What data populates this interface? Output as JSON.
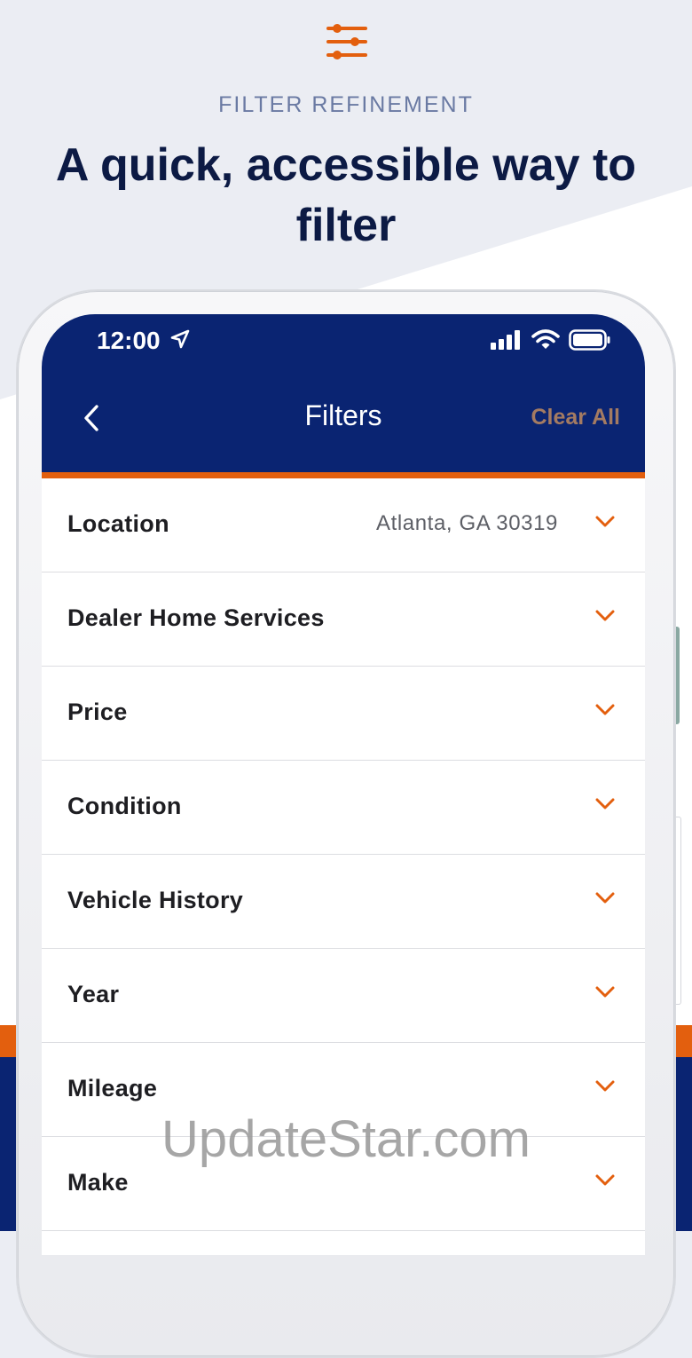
{
  "header": {
    "eyebrow": "FILTER REFINEMENT",
    "headline": "A quick, accessible way to filter",
    "icon": "sliders-icon"
  },
  "status_bar": {
    "time": "12:00",
    "icons": [
      "location-arrow-icon",
      "signal-icon",
      "wifi-icon",
      "battery-icon"
    ]
  },
  "nav": {
    "back_icon": "chevron-left-icon",
    "title": "Filters",
    "clear_all": "Clear All"
  },
  "filters": [
    {
      "label": "Location",
      "value": "Atlanta, GA 30319"
    },
    {
      "label": "Dealer Home Services",
      "value": ""
    },
    {
      "label": "Price",
      "value": ""
    },
    {
      "label": "Condition",
      "value": ""
    },
    {
      "label": "Vehicle History",
      "value": ""
    },
    {
      "label": "Year",
      "value": ""
    },
    {
      "label": "Mileage",
      "value": ""
    },
    {
      "label": "Make",
      "value": ""
    }
  ],
  "watermark": "UpdateStar.com",
  "colors": {
    "navy": "#0a2472",
    "orange": "#e35f0e",
    "clear_all": "#a47b62",
    "headline": "#0c1a44",
    "eyebrow": "#6a7aa3"
  }
}
